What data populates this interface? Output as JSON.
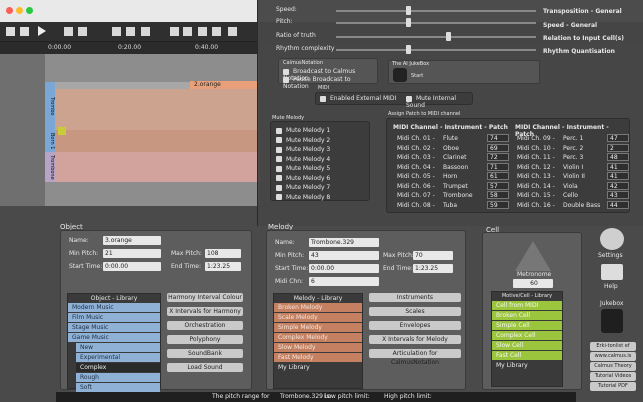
{
  "toolbar": {
    "times": [
      "0:00.00",
      "0:20.00",
      "0:40.00"
    ]
  },
  "tracks": {
    "labels": [
      "Trombo",
      "Born 1",
      "Trombone"
    ],
    "region_label": "2.orange"
  },
  "overlay": {
    "sliders": [
      {
        "label": "Speed:",
        "right": "Transposition - General",
        "level": 0.35
      },
      {
        "label": "Pitch:",
        "right": "Speed - General",
        "level": 0.35
      },
      {
        "label": "Ratio of truth",
        "right": "Relation to Input Cell(s)",
        "level": 0.55
      },
      {
        "label": "Rhythm complexity",
        "right": "Rhythm Quantisation",
        "level": 0.35
      }
    ],
    "calmus": {
      "title": "CalmusNotation",
      "opt1": "Broadcast to Calmus Notation",
      "opt2": "Pause Broadcast to Notation"
    },
    "jukebox": {
      "title": "The AI JukeBox",
      "start": "Start"
    },
    "midi": {
      "title": "MIDI",
      "enable": "Enabled External MIDI",
      "mute": "Mute Internal Sound"
    },
    "mute_melody": {
      "title": "Mute Melody",
      "items": [
        "Mute Melody 1",
        "Mute Melody 2",
        "Mute Melody 3",
        "Mute Melody 4",
        "Mute Melody 5",
        "Mute Melody 6",
        "Mute Melody 7",
        "Mute Melody 8"
      ]
    },
    "assign": {
      "title": "Assign Patch to MIDI channel",
      "header": "MIDI Channel  -  Instrument  -  Patch",
      "left": [
        [
          "Midi Ch. 01 -",
          "Flute",
          "74"
        ],
        [
          "Midi Ch. 02 -",
          "Oboe",
          "69"
        ],
        [
          "Midi Ch. 03 -",
          "Clarinet",
          "72"
        ],
        [
          "Midi Ch. 04 -",
          "Bassoon",
          "71"
        ],
        [
          "Midi Ch. 05 -",
          "Horn",
          "61"
        ],
        [
          "Midi Ch. 06 -",
          "Trumpet",
          "57"
        ],
        [
          "Midi Ch. 07 -",
          "Trombone",
          "58"
        ],
        [
          "Midi Ch. 08 -",
          "Tuba",
          "59"
        ]
      ],
      "right": [
        [
          "Midi Ch. 09 -",
          "Perc. 1",
          "47"
        ],
        [
          "Midi Ch. 10 -",
          "Perc. 2",
          "2"
        ],
        [
          "Midi Ch. 11 -",
          "Perc. 3",
          "48"
        ],
        [
          "Midi Ch. 12 -",
          "Violin I",
          "41"
        ],
        [
          "Midi Ch. 13 -",
          "Violin II",
          "41"
        ],
        [
          "Midi Ch. 14 -",
          "Viola",
          "42"
        ],
        [
          "Midi Ch. 15 -",
          "Cello",
          "43"
        ],
        [
          "Midi Ch. 16 -",
          "Double Bass",
          "44"
        ]
      ]
    }
  },
  "object": {
    "title": "Object",
    "name_label": "Name:",
    "name": "3.orange",
    "minpitch_label": "Min Pitch:",
    "minpitch": "21",
    "maxpitch_label": "Max Pitch:",
    "maxpitch": "108",
    "start_label": "Start Time:",
    "start": "0:00.00",
    "end_label": "End Time:",
    "end": "1:23.25",
    "lib_title": "Object - Library",
    "lib_items": [
      "Modern Music",
      "Film Music",
      "Stage Music",
      "Game Music",
      "New",
      "Experimental",
      "Complex",
      "Rough",
      "Soft"
    ],
    "buttons": [
      "Harmony Interval Colour",
      "X Intervals for Harmony",
      "Orchestration",
      "Polyphony",
      "SoundBank",
      "Load Sound"
    ]
  },
  "melody": {
    "title": "Melody",
    "name_label": "Name:",
    "name": "Trombone.329",
    "minpitch_label": "Min Pitch:",
    "minpitch": "43",
    "maxpitch_label": "Max Pitch:",
    "maxpitch": "70",
    "start_label": "Start Time:",
    "start": "0:00.00",
    "end_label": "End Time:",
    "end": "1:23.25",
    "midi_label": "Midi Chn:",
    "midi": "6",
    "lib_title": "Melody - Library",
    "lib_items": [
      "Broken Melody",
      "Scale Melody",
      "Simple Melody",
      "Complex Melody",
      "Slow Melody",
      "Fast Melody",
      "My Library"
    ],
    "buttons": [
      "Instruments",
      "Scales",
      "Envelopes",
      "X Intervals for Melody",
      "Articulation for CalmusNotation"
    ]
  },
  "cell": {
    "title": "Cell",
    "metronome_label": "Metronome",
    "metronome": "60",
    "lib_title": "Motive/Cell - Library",
    "lib_items": [
      "Cell from MIDI",
      "Broken Cell",
      "Simple Cell",
      "Complex Cell",
      "Slow Cell",
      "Fast Cell",
      "My Library"
    ]
  },
  "sidebar": {
    "settings": "Settings",
    "help": "Help",
    "jukebox": "Jukebox",
    "buttons": [
      "Erki-tonlist ef",
      "www.calmus.is",
      "Calmus Theory",
      "Tutorial Videos",
      "Tutorial PDF"
    ]
  },
  "status": {
    "text1": "The pitch range for",
    "text2": "Trombone.329 is:",
    "text3": "Low pitch limit:",
    "text4": "High pitch limit:"
  },
  "colors": {
    "track_blue": "#7aa7d6",
    "orange": "#e9a07a",
    "lib_orange": "#c48060",
    "lib_green": "#9bc53d",
    "lib_blue": "#8fb1d6"
  }
}
